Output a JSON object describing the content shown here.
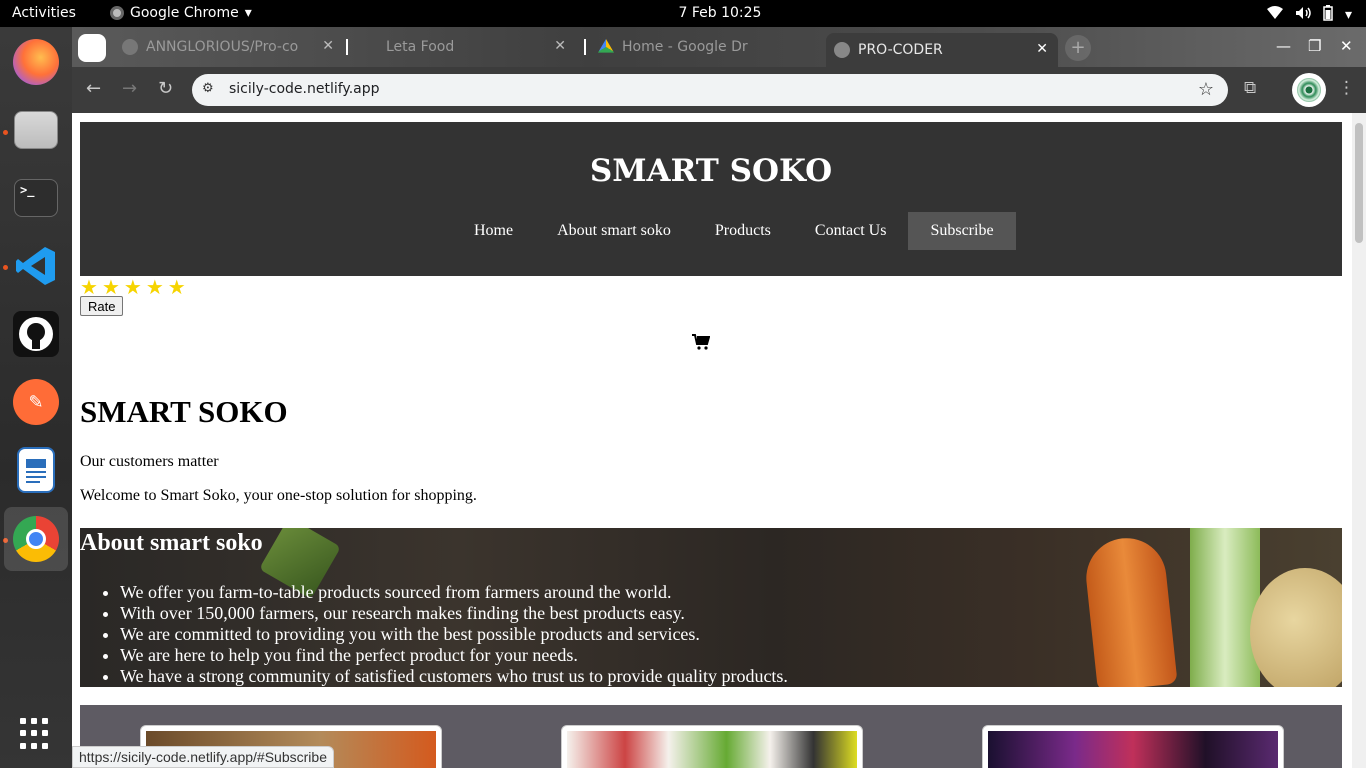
{
  "topbar": {
    "activities": "Activities",
    "app_name": "Google Chrome",
    "clock": "7 Feb  10:25"
  },
  "dock": {
    "apps": [
      "firefox",
      "files",
      "terminal",
      "vscode",
      "github-desktop",
      "postman",
      "libreoffice-writer",
      "chrome"
    ]
  },
  "browser": {
    "tabs": [
      {
        "title": "ANNGLORIOUS/Pro-co",
        "icon": "github-icon"
      },
      {
        "title": "Leta Food",
        "icon": "globe-icon"
      },
      {
        "title": "Home - Google Dr",
        "icon": "drive-icon"
      },
      {
        "title": "PRO-CODER",
        "icon": "netlify-icon",
        "active": true
      }
    ],
    "url": "sicily-code.netlify.app",
    "status_url": "https://sicily-code.netlify.app/#Subscribe"
  },
  "site": {
    "brand": "SMART SOKO",
    "nav": [
      {
        "label": "Home"
      },
      {
        "label": "About smart soko"
      },
      {
        "label": "Products"
      },
      {
        "label": "Contact Us"
      },
      {
        "label": "Subscribe",
        "active": true
      }
    ],
    "stars": [
      "★",
      "★",
      "★",
      "★",
      "★"
    ],
    "rate_button": "Rate",
    "cart_icon": "🛒",
    "heading": "SMART SOKO",
    "tagline": "Our customers matter",
    "welcome": "Welcome to Smart Soko, your one-stop solution for shopping.",
    "about": {
      "title": "About smart soko",
      "items": [
        "We offer you farm-to-table products sourced from farmers around the world.",
        "With over 150,000 farmers, our research makes finding the best products easy.",
        "We are committed to providing you with the best possible products and services.",
        "We are here to help you find the perfect product for your needs.",
        "We have a strong community of satisfied customers who trust us to provide quality products."
      ]
    }
  }
}
